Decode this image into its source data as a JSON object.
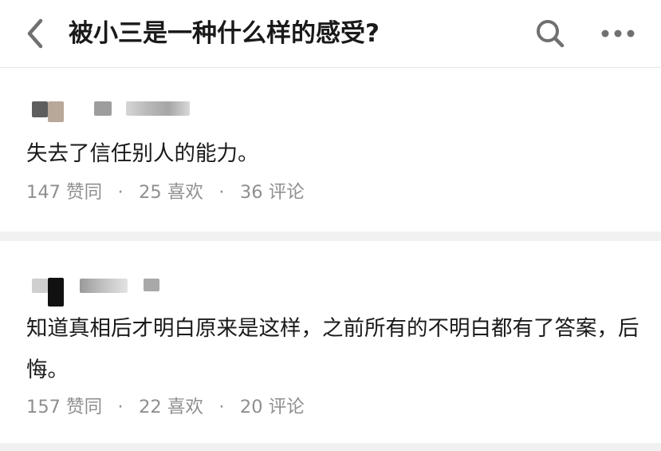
{
  "header": {
    "title": "被小三是一种什么样的感受?",
    "icons": {
      "back": "chevron-left-icon",
      "search": "search-icon",
      "more": "more-dots-icon"
    }
  },
  "answers": [
    {
      "content": "失去了信任别人的能力。",
      "likes": "147 赞同",
      "favorites": "25 喜欢",
      "comments": "36 评论"
    },
    {
      "content": "知道真相后才明白原来是这样，之前所有的不明白都有了答案，后悔。",
      "likes": "157 赞同",
      "favorites": "22 喜欢",
      "comments": "20 评论"
    }
  ],
  "colors": {
    "text": "#1a1a1a",
    "meta": "#8f8f8f",
    "divider": "#f1f1f1",
    "icon": "#707070"
  }
}
